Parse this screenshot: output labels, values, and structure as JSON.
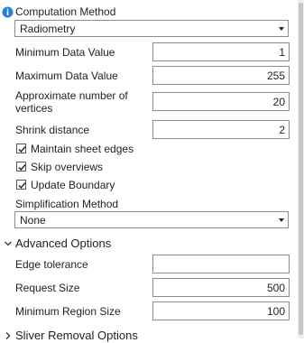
{
  "computation": {
    "label": "Computation Method",
    "selected": "Radiometry"
  },
  "fields": [
    {
      "label": "Minimum Data Value",
      "value": "1"
    },
    {
      "label": "Maximum Data Value",
      "value": "255"
    },
    {
      "label_line1": "Approximate number of",
      "label_line2": "vertices",
      "value": "20"
    },
    {
      "label": "Shrink distance",
      "value": "2"
    }
  ],
  "checkboxes": [
    {
      "label": "Maintain sheet edges",
      "checked": true
    },
    {
      "label": "Skip overviews",
      "checked": true
    },
    {
      "label": "Update Boundary",
      "checked": true
    }
  ],
  "simplification": {
    "label": "Simplification Method",
    "selected": "None"
  },
  "advanced": {
    "title": "Advanced Options",
    "fields": [
      {
        "label": "Edge tolerance",
        "value": ""
      },
      {
        "label": "Request Size",
        "value": "500"
      },
      {
        "label": "Minimum Region Size",
        "value": "100"
      }
    ]
  },
  "sliver": {
    "title": "Sliver Removal Options"
  },
  "icons": {
    "info": "info-icon",
    "expanded": "chevron-down-icon",
    "collapsed": "chevron-right-icon"
  },
  "colors": {
    "info_blue": "#2a7fd1"
  }
}
